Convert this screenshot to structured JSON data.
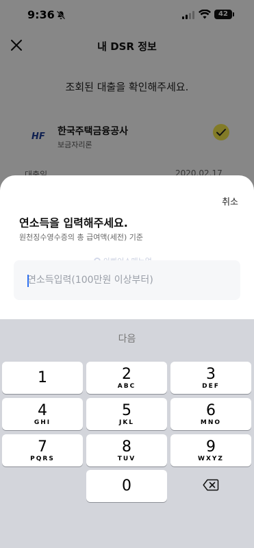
{
  "status_bar": {
    "time": "9:36",
    "battery": "42"
  },
  "page": {
    "title": "내 DSR 정보",
    "subtitle": "조회된 대출을 확인해주세요."
  },
  "loan": {
    "logo": "HF",
    "name": "한국주택금융공사",
    "type": "보금자리론",
    "date_label": "대출일",
    "date": "2020.02.17"
  },
  "sheet": {
    "cancel_label": "취소",
    "title": "연소득을 입력해주세요.",
    "description": "원천징수영수증의 총 급여액(세전) 기준",
    "watermark": "아빠어스매뉴얼",
    "input_placeholder": "연소득입력(100만원 이상부터)",
    "input_value": ""
  },
  "keyboard": {
    "next_label": "다음",
    "keys": [
      {
        "num": "1",
        "letters": ""
      },
      {
        "num": "2",
        "letters": "ABC"
      },
      {
        "num": "3",
        "letters": "DEF"
      },
      {
        "num": "4",
        "letters": "GHI"
      },
      {
        "num": "5",
        "letters": "JKL"
      },
      {
        "num": "6",
        "letters": "MNO"
      },
      {
        "num": "7",
        "letters": "PQRS"
      },
      {
        "num": "8",
        "letters": "TUV"
      },
      {
        "num": "9",
        "letters": "WXYZ"
      },
      {
        "num": "0",
        "letters": ""
      }
    ],
    "delete_icon": "backspace-icon"
  },
  "colors": {
    "dim_overlay": "#000000",
    "accent_check": "#f5e94a",
    "caret": "#2d6ff0",
    "keyboard_bg": "#d3d5db"
  }
}
